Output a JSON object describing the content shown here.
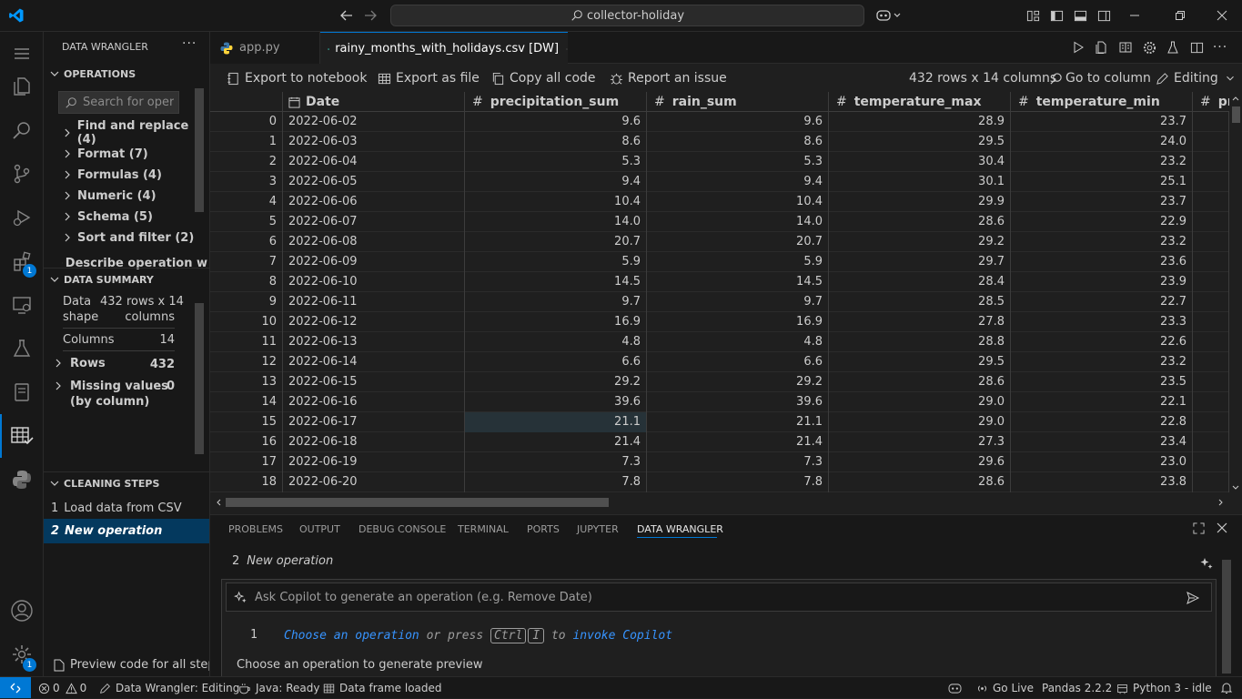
{
  "titlebar": {
    "search_text": "collector-holiday"
  },
  "activity_bar": {
    "extensions_badge": "1",
    "settings_badge": "1"
  },
  "sidebar": {
    "title": "DATA WRANGLER",
    "operations_header": "OPERATIONS",
    "search_placeholder": "Search for oper",
    "operations": [
      {
        "label": "Find and replace (4)"
      },
      {
        "label": "Format (7)"
      },
      {
        "label": "Formulas (4)"
      },
      {
        "label": "Numeric (4)"
      },
      {
        "label": "Schema (5)"
      },
      {
        "label": "Sort and filter (2)"
      }
    ],
    "describe_label": "Describe operation w",
    "summary_header": "DATA SUMMARY",
    "summary": {
      "shape_label_1": "Data",
      "shape_label_2": "shape",
      "shape_value_1": "432 rows x 14",
      "shape_value_2": "columns",
      "columns_label": "Columns",
      "columns_value": "14",
      "rows_label": "Rows",
      "rows_value": "432",
      "missing_label_1": "Missing values",
      "missing_label_2": "(by column)",
      "missing_value": "0"
    },
    "cleaning_header": "CLEANING STEPS",
    "steps": [
      {
        "num": "1",
        "label": "Load data from CSV"
      },
      {
        "num": "2",
        "label": "New operation"
      }
    ],
    "preview_label": "Preview code for all steps"
  },
  "tabs": [
    {
      "label": "app.py"
    },
    {
      "label": "rainy_months_with_holidays.csv [DW]"
    }
  ],
  "toolbar": {
    "export_notebook": "Export to notebook",
    "export_file": "Export as file",
    "copy_code": "Copy all code",
    "report_issue": "Report an issue",
    "shape": "432 rows x 14 columns",
    "go_to_column": "Go to column",
    "editing": "Editing"
  },
  "grid": {
    "columns": [
      {
        "label": "Date"
      },
      {
        "label": "precipitation_sum"
      },
      {
        "label": "rain_sum"
      },
      {
        "label": "temperature_max"
      },
      {
        "label": "temperature_min"
      },
      {
        "label": "pr"
      }
    ],
    "rows": [
      [
        "0",
        "2022-06-02",
        "9.6",
        "9.6",
        "28.9",
        "23.7"
      ],
      [
        "1",
        "2022-06-03",
        "8.6",
        "8.6",
        "29.5",
        "24.0"
      ],
      [
        "2",
        "2022-06-04",
        "5.3",
        "5.3",
        "30.4",
        "23.2"
      ],
      [
        "3",
        "2022-06-05",
        "9.4",
        "9.4",
        "30.1",
        "25.1"
      ],
      [
        "4",
        "2022-06-06",
        "10.4",
        "10.4",
        "29.9",
        "23.7"
      ],
      [
        "5",
        "2022-06-07",
        "14.0",
        "14.0",
        "28.6",
        "22.9"
      ],
      [
        "6",
        "2022-06-08",
        "20.7",
        "20.7",
        "29.2",
        "23.2"
      ],
      [
        "7",
        "2022-06-09",
        "5.9",
        "5.9",
        "29.7",
        "23.6"
      ],
      [
        "8",
        "2022-06-10",
        "14.5",
        "14.5",
        "28.4",
        "23.9"
      ],
      [
        "9",
        "2022-06-11",
        "9.7",
        "9.7",
        "28.5",
        "22.7"
      ],
      [
        "10",
        "2022-06-12",
        "16.9",
        "16.9",
        "27.8",
        "23.3"
      ],
      [
        "11",
        "2022-06-13",
        "4.8",
        "4.8",
        "28.8",
        "22.6"
      ],
      [
        "12",
        "2022-06-14",
        "6.6",
        "6.6",
        "29.5",
        "23.2"
      ],
      [
        "13",
        "2022-06-15",
        "29.2",
        "29.2",
        "28.6",
        "23.5"
      ],
      [
        "14",
        "2022-06-16",
        "39.6",
        "39.6",
        "29.0",
        "22.1"
      ],
      [
        "15",
        "2022-06-17",
        "21.1",
        "21.1",
        "29.0",
        "22.8"
      ],
      [
        "16",
        "2022-06-18",
        "21.4",
        "21.4",
        "27.3",
        "23.4"
      ],
      [
        "17",
        "2022-06-19",
        "7.3",
        "7.3",
        "29.6",
        "23.0"
      ],
      [
        "18",
        "2022-06-20",
        "7.8",
        "7.8",
        "28.6",
        "23.8"
      ]
    ]
  },
  "panel": {
    "tabs": [
      {
        "label": "PROBLEMS"
      },
      {
        "label": "OUTPUT"
      },
      {
        "label": "DEBUG CONSOLE"
      },
      {
        "label": "TERMINAL"
      },
      {
        "label": "PORTS"
      },
      {
        "label": "JUPYTER"
      },
      {
        "label": "DATA WRANGLER"
      }
    ],
    "step_num": "2",
    "step_title": "New operation",
    "copilot_placeholder": "Ask Copilot to generate an operation (e.g. Remove Date)",
    "code_line_num": "1",
    "code_part1": "Choose",
    "code_part2": "an",
    "code_part3": "operation",
    "code_part4": "or press",
    "code_key1": "Ctrl",
    "code_key2": "I",
    "code_part5": "to",
    "code_part6": "invoke",
    "code_part7": "Copilot",
    "preview_message": "Choose an operation to generate preview"
  },
  "statusbar": {
    "errors": "0",
    "warnings": "0",
    "mode": "Data Wrangler: Editing",
    "java": "Java: Ready",
    "frame": "Data frame loaded",
    "golive": "Go Live",
    "pandas": "Pandas 2.2.2",
    "python": "Python 3 - idle"
  },
  "colors": {
    "accent": "#0078d4",
    "selected_step_bg": "#04395e",
    "code_blue": "#3794ff",
    "brand_vscode": "#0098ff"
  }
}
